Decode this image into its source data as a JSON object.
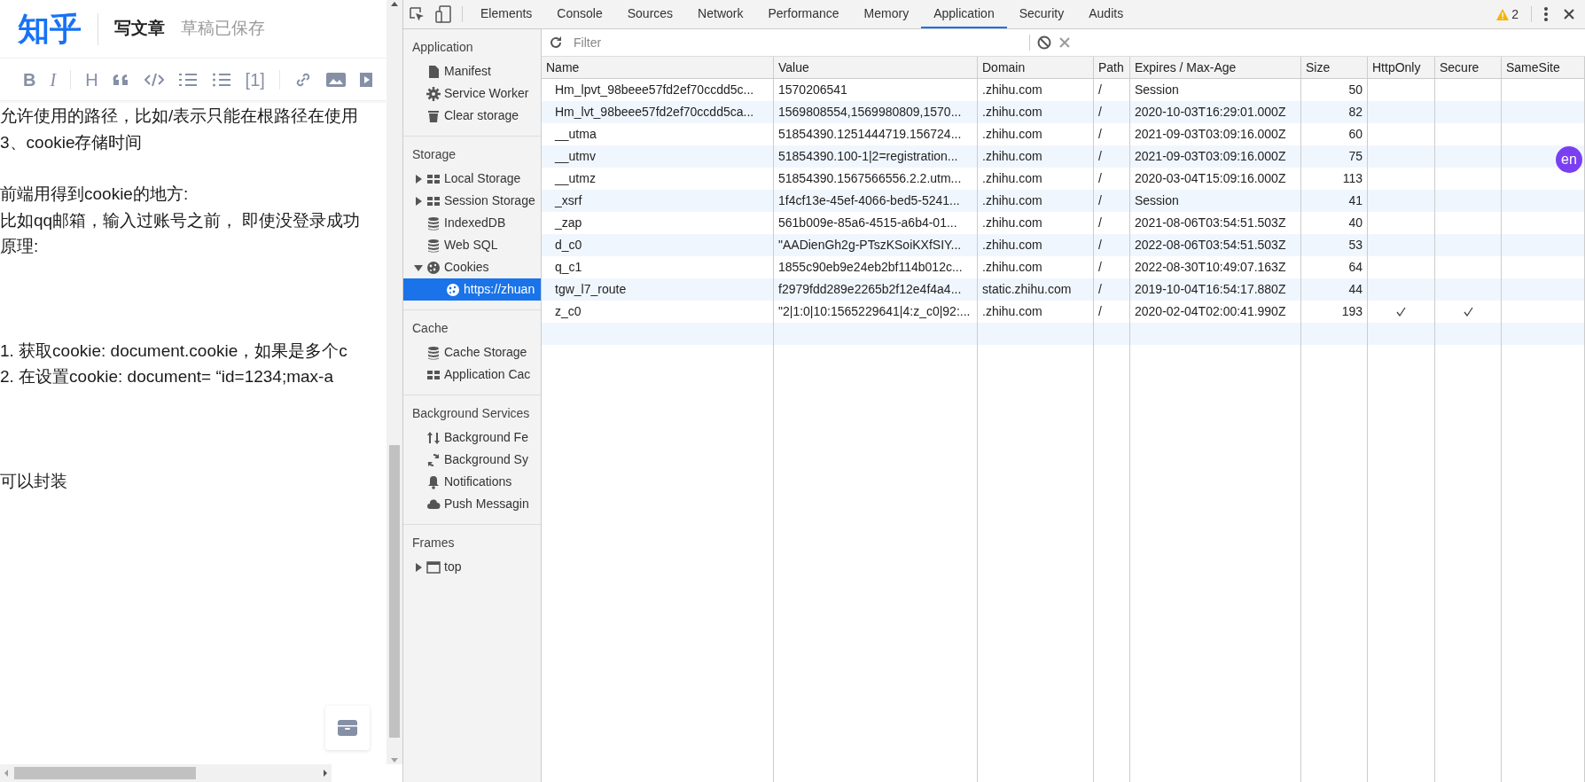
{
  "editor": {
    "logo": "知乎",
    "title": "写文章",
    "save_status": "草稿已保存",
    "toolbar_glyphs": [
      "B",
      "I",
      "H",
      "[1]"
    ],
    "blocks": [
      [
        "允许使用的路径，比如/表示只能在根路径在使用",
        "3、cookie存储时间"
      ],
      [
        "前端用得到cookie的地方:",
        "比如qq邮箱，输入过账号之前， 即使没登录成功",
        "原理:"
      ],
      [
        "1. 获取cookie: document.cookie，如果是多个c",
        "2. 在设置cookie: document= “id=1234;max-a"
      ],
      [
        "可以封装"
      ]
    ]
  },
  "devtools": {
    "tabs": [
      {
        "label": "Elements",
        "selected": false
      },
      {
        "label": "Console",
        "selected": false
      },
      {
        "label": "Sources",
        "selected": false
      },
      {
        "label": "Network",
        "selected": false
      },
      {
        "label": "Performance",
        "selected": false
      },
      {
        "label": "Memory",
        "selected": false
      },
      {
        "label": "Application",
        "selected": true
      },
      {
        "label": "Security",
        "selected": false
      },
      {
        "label": "Audits",
        "selected": false
      }
    ],
    "warning_count": "2",
    "sidebar": [
      {
        "title": "Application",
        "items": [
          {
            "label": "Manifest",
            "kind": "leaf",
            "selected": false
          },
          {
            "label": "Service Worker",
            "kind": "leaf",
            "selected": false
          },
          {
            "label": "Clear storage",
            "kind": "leaf",
            "selected": false
          }
        ]
      },
      {
        "title": "Storage",
        "items": [
          {
            "label": "Local Storage",
            "kind": "node",
            "expanded": false,
            "selected": false
          },
          {
            "label": "Session Storage",
            "kind": "node",
            "expanded": false,
            "selected": false
          },
          {
            "label": "IndexedDB",
            "kind": "leaf",
            "selected": false
          },
          {
            "label": "Web SQL",
            "kind": "leaf",
            "selected": false
          },
          {
            "label": "Cookies",
            "kind": "node",
            "expanded": true,
            "selected": false,
            "children": [
              {
                "label": "https://zhuan",
                "selected": true
              }
            ]
          }
        ]
      },
      {
        "title": "Cache",
        "items": [
          {
            "label": "Cache Storage",
            "kind": "leaf",
            "selected": false
          },
          {
            "label": "Application Cac",
            "kind": "leaf",
            "selected": false
          }
        ]
      },
      {
        "title": "Background Services",
        "items": [
          {
            "label": "Background Fe",
            "kind": "leaf",
            "selected": false
          },
          {
            "label": "Background Sy",
            "kind": "leaf",
            "selected": false
          },
          {
            "label": "Notifications",
            "kind": "leaf",
            "selected": false
          },
          {
            "label": "Push Messagin",
            "kind": "leaf",
            "selected": false
          }
        ]
      },
      {
        "title": "Frames",
        "items": [
          {
            "label": "top",
            "kind": "node",
            "expanded": false,
            "selected": false
          }
        ]
      }
    ],
    "filter": {
      "placeholder": "Filter"
    },
    "table": {
      "columns": [
        "Name",
        "Value",
        "Domain",
        "Path",
        "Expires / Max-Age",
        "Size",
        "HttpOnly",
        "Secure",
        "SameSite"
      ],
      "rows": [
        {
          "name": "Hm_lpvt_98beee57fd2ef70ccdd5c...",
          "value": "1570206541",
          "domain": ".zhihu.com",
          "path": "/",
          "expires": "Session",
          "size": "50",
          "http_only": false,
          "secure": false
        },
        {
          "name": "Hm_lvt_98beee57fd2ef70ccdd5ca...",
          "value": "1569808554,1569980809,1570...",
          "domain": ".zhihu.com",
          "path": "/",
          "expires": "2020-10-03T16:29:01.000Z",
          "size": "82",
          "http_only": false,
          "secure": false
        },
        {
          "name": "__utma",
          "value": "51854390.1251444719.156724...",
          "domain": ".zhihu.com",
          "path": "/",
          "expires": "2021-09-03T03:09:16.000Z",
          "size": "60",
          "http_only": false,
          "secure": false
        },
        {
          "name": "__utmv",
          "value": "51854390.100-1|2=registration...",
          "domain": ".zhihu.com",
          "path": "/",
          "expires": "2021-09-03T03:09:16.000Z",
          "size": "75",
          "http_only": false,
          "secure": false
        },
        {
          "name": "__utmz",
          "value": "51854390.1567566556.2.2.utm...",
          "domain": ".zhihu.com",
          "path": "/",
          "expires": "2020-03-04T15:09:16.000Z",
          "size": "113",
          "http_only": false,
          "secure": false
        },
        {
          "name": "_xsrf",
          "value": "1f4cf13e-45ef-4066-bed5-5241...",
          "domain": ".zhihu.com",
          "path": "/",
          "expires": "Session",
          "size": "41",
          "http_only": false,
          "secure": false
        },
        {
          "name": "_zap",
          "value": "561b009e-85a6-4515-a6b4-01...",
          "domain": ".zhihu.com",
          "path": "/",
          "expires": "2021-08-06T03:54:51.503Z",
          "size": "40",
          "http_only": false,
          "secure": false
        },
        {
          "name": "d_c0",
          "value": "\"AADienGh2g-PTszKSoiKXfSIY...",
          "domain": ".zhihu.com",
          "path": "/",
          "expires": "2022-08-06T03:54:51.503Z",
          "size": "53",
          "http_only": false,
          "secure": false
        },
        {
          "name": "q_c1",
          "value": "1855c90eb9e24eb2bf114b012c...",
          "domain": ".zhihu.com",
          "path": "/",
          "expires": "2022-08-30T10:49:07.163Z",
          "size": "64",
          "http_only": false,
          "secure": false
        },
        {
          "name": "tgw_l7_route",
          "value": "f2979fdd289e2265b2f12e4f4a4...",
          "domain": "static.zhihu.com",
          "path": "/",
          "expires": "2019-10-04T16:54:17.880Z",
          "size": "44",
          "http_only": false,
          "secure": false
        },
        {
          "name": "z_c0",
          "value": "\"2|1:0|10:1565229641|4:z_c0|92:...",
          "domain": ".zhihu.com",
          "path": "/",
          "expires": "2020-02-04T02:00:41.990Z",
          "size": "193",
          "http_only": true,
          "secure": true
        }
      ]
    }
  },
  "overlay_badge": "en"
}
